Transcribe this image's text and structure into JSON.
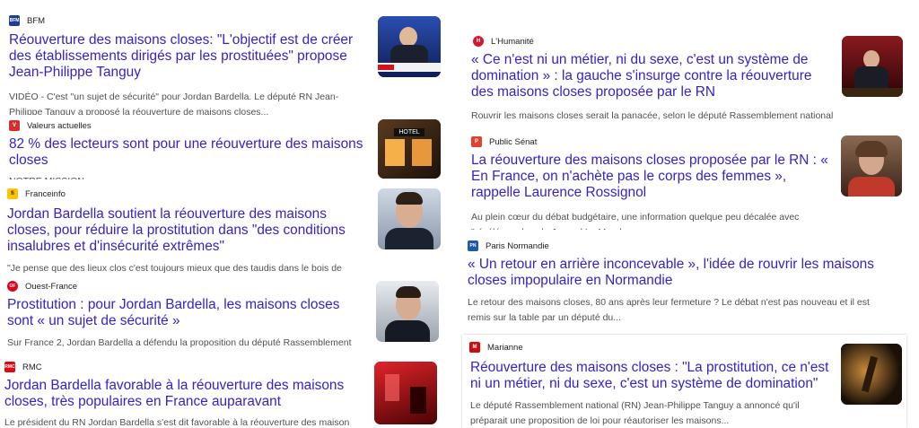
{
  "articles": [
    {
      "source": "BFM",
      "logo_text": "BFM",
      "logo_color": "#1d3f91",
      "title": "Réouverture des maisons closes: \"L'objectif est de créer des établissements dirigés par les prostituées\" propose Jean-Philippe Tanguy",
      "snippet": "VIDÉO - C'est \"un sujet de sécurité\" pour Jordan Bardella. Le député RN Jean-Philippe Tanguy a proposé la réouverture de maisons closes..."
    },
    {
      "source": "Valeurs actuelles",
      "logo_text": "V",
      "logo_color": "#d62e2e",
      "title": "82 % des lecteurs sont pour une réouverture des maisons closes",
      "snippet": "NOTRE MISSION - ...",
      "thumb_label": "HOTEL"
    },
    {
      "source": "Franceinfo",
      "logo_text": "fi",
      "logo_color": "#ffc300",
      "title": "Jordan Bardella soutient la réouverture des maisons closes, pour réduire la prostitution dans \"des conditions insalubres et d'insécurité extrêmes\"",
      "snippet": "\"Je pense que des lieux clos c'est toujours mieux que des taudis dans le bois de"
    },
    {
      "source": "Ouest-France",
      "logo_text": "OF",
      "logo_color": "#e2001a",
      "title": "Prostitution : pour Jordan Bardella, les maisons closes sont « un sujet de sécurité »",
      "snippet": "Sur France 2, Jordan Bardella a défendu la proposition du député Rassemblement"
    },
    {
      "source": "RMC",
      "logo_text": "RMC",
      "logo_color": "#e10a14",
      "title": "Jordan Bardella favorable à la réouverture des maisons closes, très populaires en France auparavant",
      "snippet": "Le président du RN Jordan Bardella s'est dit favorable à la réouverture des maison"
    },
    {
      "source": "L'Humanité",
      "logo_text": "H",
      "logo_color": "#d5162e",
      "title": "« Ce n'est ni un métier, ni du sexe, c'est un système de domination » : la gauche s'insurge contre la réouverture des maisons closes proposée par le RN",
      "snippet": "Rouvrir les maisons closes serait la panacée, selon le député Rassemblement national"
    },
    {
      "source": "Public Sénat",
      "logo_text": "P",
      "logo_color": "#e4412c",
      "title": "La réouverture des maisons closes proposée par le RN : « En France, on n'achète pas le corps des femmes », rappelle Laurence Rossignol",
      "snippet": "Au plein cœur du débat budgétaire, une information quelque peu décalée avec \"révélée ... dans le Journal Le Monde"
    },
    {
      "source": "Paris Normandie",
      "logo_text": "PN",
      "logo_color": "#1e5aa8",
      "title": "« Un retour en arrière inconcevable », l'idée de rouvrir les maisons closes impopulaire en Normandie",
      "snippet": "Le retour des maisons closes, 80 ans après leur fermeture ? Le débat n'est pas nouveau et il est remis sur la table par un député du..."
    },
    {
      "source": "Marianne",
      "logo_text": "M",
      "logo_color": "#d10a11",
      "title": "Réouverture des maisons closes : \"La prostitution, ce n'est ni un métier, ni du sexe, c'est un système de domination\"",
      "snippet": "Le député Rassemblement national (RN) Jean-Philippe Tanguy a annoncé qu'il préparait une proposition de loi pour réautoriser les maisons..."
    }
  ]
}
